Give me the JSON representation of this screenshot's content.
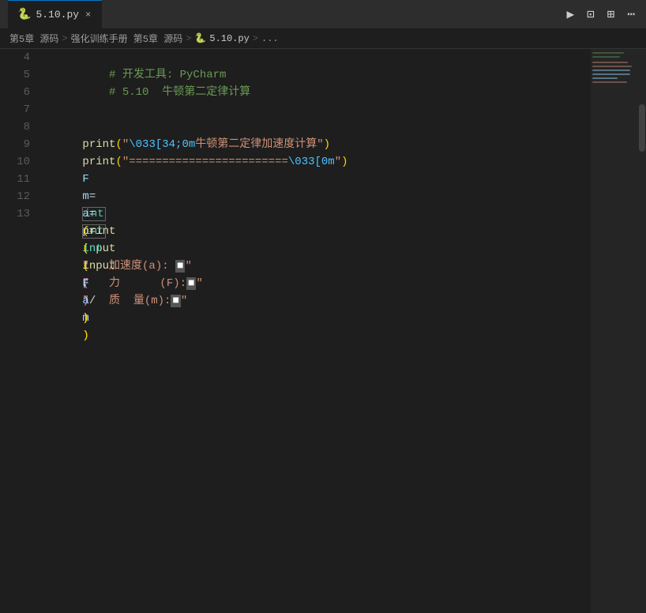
{
  "titlebar": {
    "tab_icon": "🐍",
    "tab_name": "5.10.py",
    "close_icon": "×",
    "run_icon": "▶",
    "split_icon": "⊡",
    "layout_icon": "⊞",
    "more_icon": "⋯"
  },
  "breadcrumb": {
    "parts": [
      {
        "label": "第5章 源码",
        "type": "text"
      },
      {
        "label": ">",
        "type": "sep"
      },
      {
        "label": "强化训练手册 第5章 源码",
        "type": "text"
      },
      {
        "label": ">",
        "type": "sep"
      },
      {
        "label": "🐍 5.10.py",
        "type": "file"
      },
      {
        "label": ">",
        "type": "sep"
      },
      {
        "label": "...",
        "type": "text"
      }
    ]
  },
  "lines": [
    {
      "num": "4",
      "content": "comment",
      "text": "# 开发工具: PyCharm"
    },
    {
      "num": "5",
      "content": "comment",
      "text": "# 5.10  牛顿第二定律计算"
    },
    {
      "num": "6",
      "content": "empty",
      "text": ""
    },
    {
      "num": "7",
      "content": "print1",
      "text": "print(\"\\033[34;0m牛顿第二定律加速度计算\")"
    },
    {
      "num": "8",
      "content": "print2",
      "text": "print(\"========================\\033[0m\")"
    },
    {
      "num": "9",
      "content": "assign_F",
      "text": "F = int(input(\"   力      (F):■\"))"
    },
    {
      "num": "10",
      "content": "assign_m",
      "text": "m = int(input(\"   质  量(m):■\"))"
    },
    {
      "num": "11",
      "content": "assign_a",
      "text": "a = int(F / m)"
    },
    {
      "num": "12",
      "content": "print3",
      "text": "print(\"   加速度(a): ■\", a)"
    },
    {
      "num": "13",
      "content": "empty",
      "text": ""
    }
  ]
}
